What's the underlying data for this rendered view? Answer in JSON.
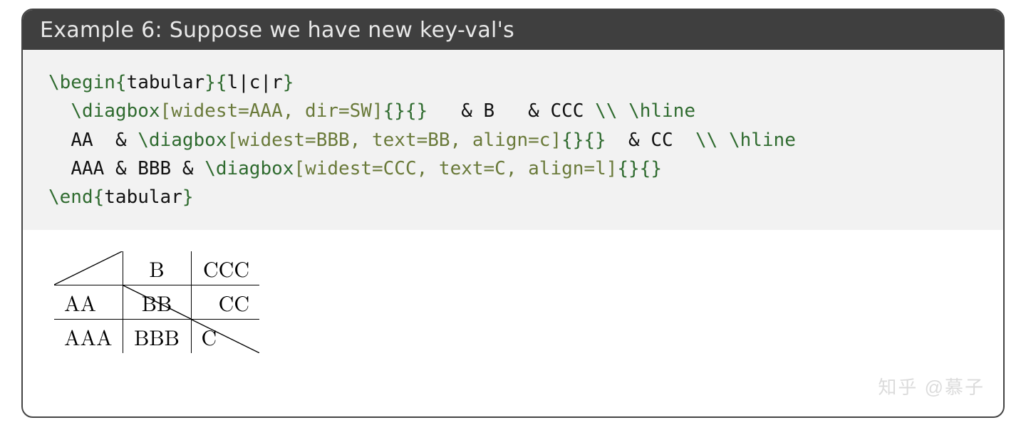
{
  "title": "Example 6: Suppose we have new key-val's",
  "code": {
    "l1": {
      "cmd": "\\begin",
      "arg": "tabular",
      "spec": "l|c|r"
    },
    "l2": {
      "cmd": "\\diagbox",
      "opts": "widest=AAA, dir=SW",
      "args": "{}{}",
      "amp1": "&",
      "b": "B",
      "amp2": "&",
      "ccc": "CCC",
      "nl": "\\\\",
      "hline": "\\hline"
    },
    "l3": {
      "aa": "AA",
      "amp1": "&",
      "cmd": "\\diagbox",
      "opts": "widest=BBB, text=BB, align=c",
      "args": "{}{}",
      "amp2": "&",
      "cc": "CC",
      "nl": "\\\\",
      "hline": "\\hline"
    },
    "l4": {
      "aaa": "AAA",
      "amp1": "&",
      "bbb": "BBB",
      "amp2": "&",
      "cmd": "\\diagbox",
      "opts": "widest=CCC, text=C, align=l",
      "args": "{}{}"
    },
    "l5": {
      "cmd": "\\end",
      "arg": "tabular"
    }
  },
  "table": {
    "row1": {
      "c1": "",
      "c2": "B",
      "c3": "CCC"
    },
    "row2": {
      "c1": "AA",
      "c2": "BB",
      "c3": "CC"
    },
    "row3": {
      "c1": "AAA",
      "c2": "BBB",
      "c3": "C"
    }
  },
  "watermark": "知乎 @慕子"
}
